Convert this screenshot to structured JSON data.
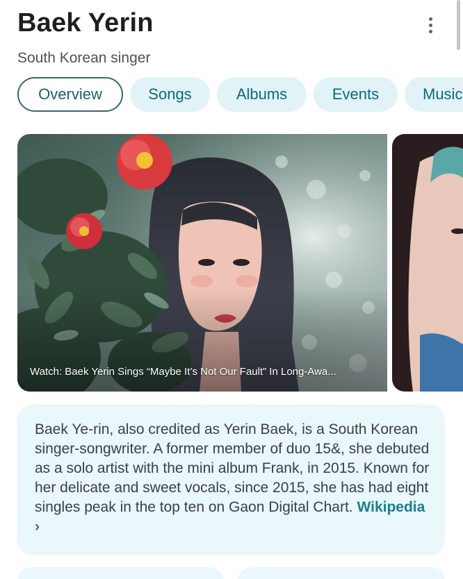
{
  "entity": {
    "title": "Baek Yerin",
    "subtitle": "South Korean singer"
  },
  "menu": {
    "icon": "more-vert-icon"
  },
  "tabs": [
    {
      "label": "Overview",
      "active": true
    },
    {
      "label": "Songs",
      "active": false
    },
    {
      "label": "Albums",
      "active": false
    },
    {
      "label": "Events",
      "active": false
    },
    {
      "label": "Music",
      "active": false
    }
  ],
  "media": {
    "caption": "Watch: Baek Yerin Sings “Maybe It’s Not Our Fault” In Long-Awa..."
  },
  "description": {
    "text": "Baek Ye-rin, also credited as Yerin Baek, is a South Korean singer-songwriter. A former member of duo 15&, she debuted as a solo artist with the mini album Frank, in 2015. Known for her delicate and sweet vocals, since 2015, she has had eight singles peak in the top ten on Gaon Digital Chart.",
    "link_label": "Wikipedia",
    "link_chevron": "›"
  },
  "colors": {
    "accent": "#1a7f92",
    "tab_bg": "#e2f3f7",
    "card_bg": "#eaf7fb"
  }
}
